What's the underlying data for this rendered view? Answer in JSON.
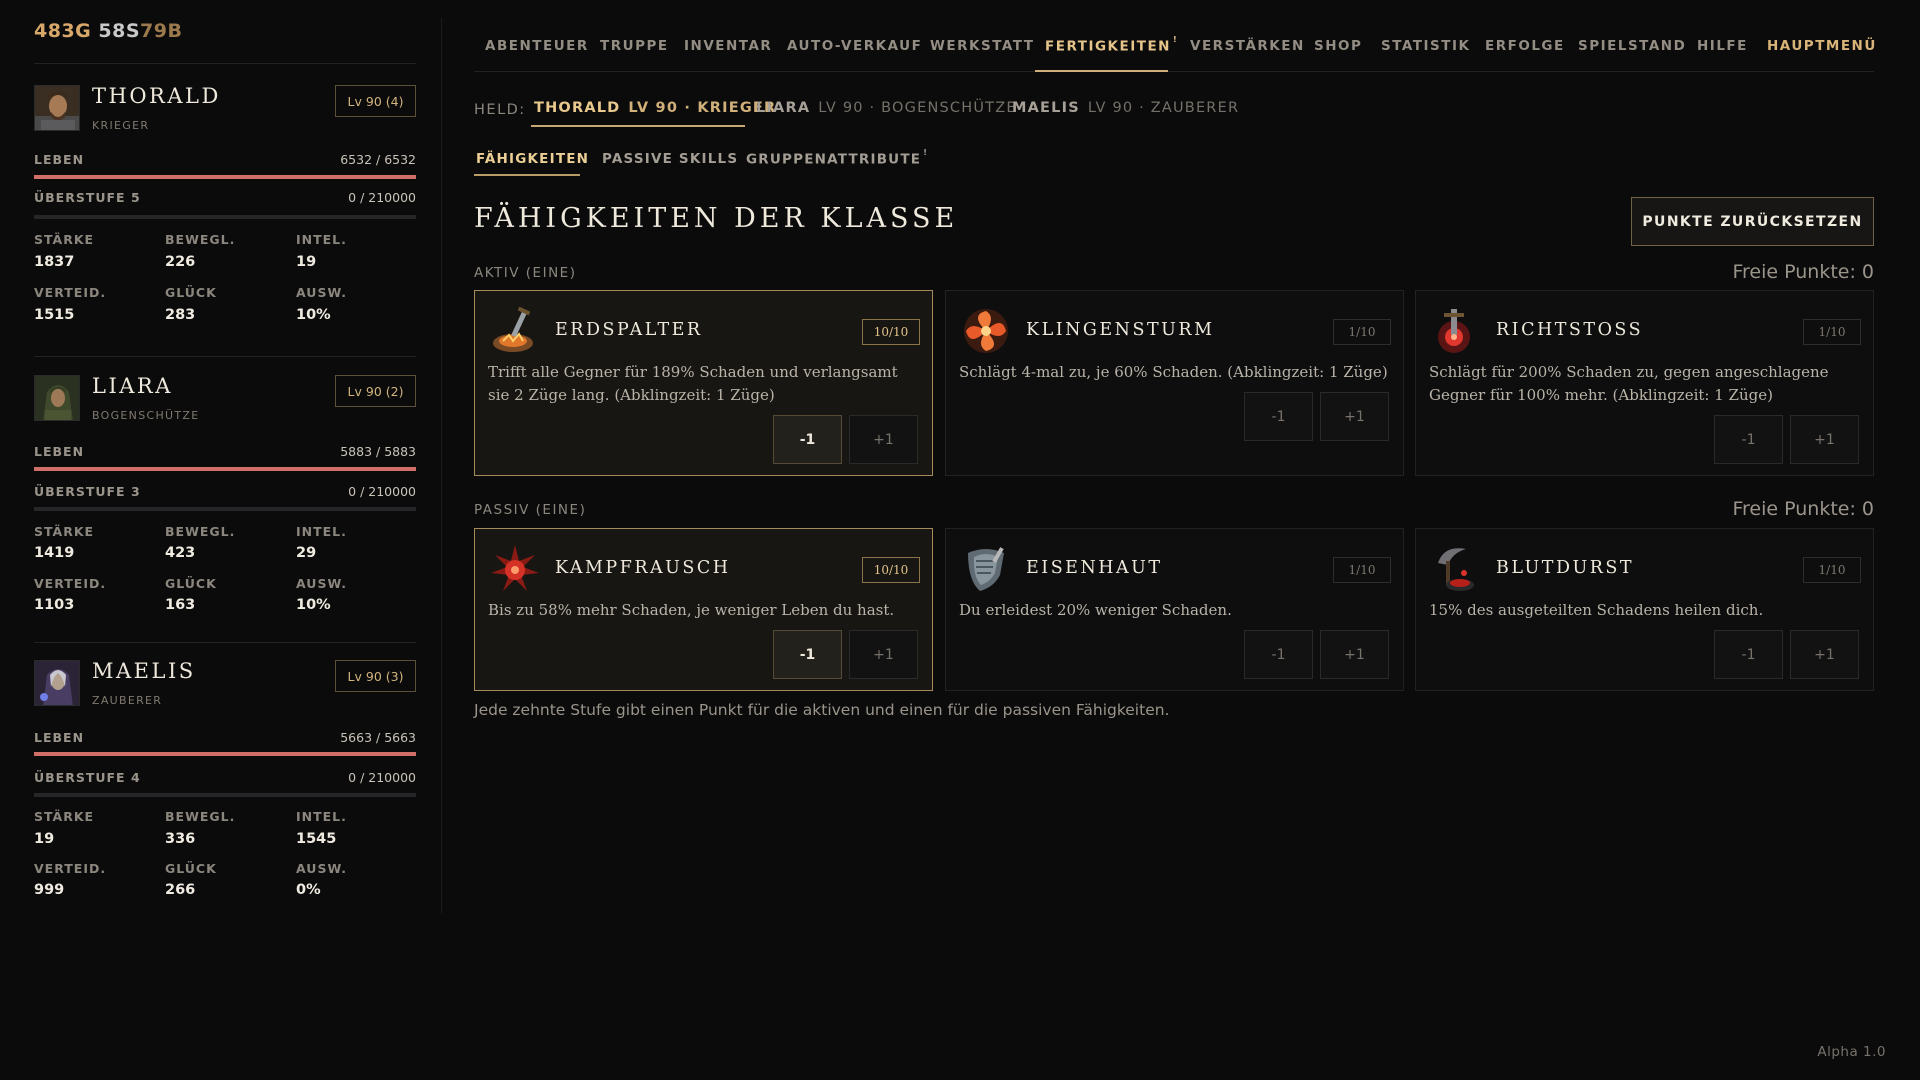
{
  "currency": {
    "gold": "483G",
    "silver": "58S",
    "bronze": "79B"
  },
  "heroes": [
    {
      "name": "THORALD",
      "class": "KRIEGER",
      "level": "Lv 90 (4)",
      "life_label": "LEBEN",
      "life": "6532 / 6532",
      "life_fraction": 1.0,
      "overlevel_label": "ÜBERSTUFE 5",
      "overlevel_xp": "0 / 210000",
      "overlevel_fraction": 0,
      "attrs": [
        {
          "label": "STÄRKE",
          "value": "1837"
        },
        {
          "label": "BEWEGL.",
          "value": "226"
        },
        {
          "label": "INTEL.",
          "value": "19"
        },
        {
          "label": "VERTEID.",
          "value": "1515"
        },
        {
          "label": "GLÜCK",
          "value": "283"
        },
        {
          "label": "AUSW.",
          "value": "10%"
        }
      ]
    },
    {
      "name": "LIARA",
      "class": "BOGENSCHÜTZE",
      "level": "Lv 90 (2)",
      "life_label": "LEBEN",
      "life": "5883 / 5883",
      "life_fraction": 1.0,
      "overlevel_label": "ÜBERSTUFE 3",
      "overlevel_xp": "0 / 210000",
      "overlevel_fraction": 0,
      "attrs": [
        {
          "label": "STÄRKE",
          "value": "1419"
        },
        {
          "label": "BEWEGL.",
          "value": "423"
        },
        {
          "label": "INTEL.",
          "value": "29"
        },
        {
          "label": "VERTEID.",
          "value": "1103"
        },
        {
          "label": "GLÜCK",
          "value": "163"
        },
        {
          "label": "AUSW.",
          "value": "10%"
        }
      ]
    },
    {
      "name": "MAELIS",
      "class": "ZAUBERER",
      "level": "Lv 90 (3)",
      "life_label": "LEBEN",
      "life": "5663 / 5663",
      "life_fraction": 1.0,
      "overlevel_label": "ÜBERSTUFE 4",
      "overlevel_xp": "0 / 210000",
      "overlevel_fraction": 0,
      "attrs": [
        {
          "label": "STÄRKE",
          "value": "19"
        },
        {
          "label": "BEWEGL.",
          "value": "336"
        },
        {
          "label": "INTEL.",
          "value": "1545"
        },
        {
          "label": "VERTEID.",
          "value": "999"
        },
        {
          "label": "GLÜCK",
          "value": "266"
        },
        {
          "label": "AUSW.",
          "value": "0%"
        }
      ]
    }
  ],
  "nav": {
    "items": [
      "ABENTEUER",
      "TRUPPE",
      "INVENTAR",
      "AUTO-VERKAUF",
      "WERKSTATT",
      "FERTIGKEITEN",
      "VERSTÄRKEN",
      "SHOP",
      "STATISTIK",
      "ERFOLGE",
      "SPIELSTAND",
      "HILFE",
      "HAUPTMENÜ"
    ],
    "active": "FERTIGKEITEN",
    "badge": "!"
  },
  "hero_select": {
    "label": "HELD:",
    "tabs": [
      {
        "name": "THORALD",
        "info": "LV 90 · KRIEGER"
      },
      {
        "name": "LIARA",
        "info": "LV 90 · BOGENSCHÜTZE"
      },
      {
        "name": "MAELIS",
        "info": "LV 90 · ZAUBERER"
      }
    ]
  },
  "subtabs": {
    "items": [
      "FÄHIGKEITEN",
      "PASSIVE SKILLS",
      "GRUPPENATTRIBUTE"
    ],
    "badge": "!"
  },
  "page": {
    "title": "FÄHIGKEITEN DER KLASSE",
    "reset_label": "PUNKTE ZURÜCKSETZEN",
    "active_label": "AKTIV (EINE)",
    "passive_label": "PASSIV (EINE)",
    "free_points_active": "Freie Punkte: 0",
    "free_points_passive": "Freie Punkte: 0",
    "footnote": "Jede zehnte Stufe gibt einen Punkt für die aktiven und einen für die passiven Fähigkeiten.",
    "minus_label": "-1",
    "plus_label": "+1"
  },
  "skills_active": [
    {
      "name": "ERDSPALTER",
      "rank": "10/10",
      "icon": "earth-sword-icon",
      "desc": "Trifft alle Gegner für 189% Schaden und verlangsamt sie 2 Züge lang. (Abklingzeit: 1 Züge)"
    },
    {
      "name": "KLINGENSTURM",
      "rank": "1/10",
      "icon": "blade-vortex-icon",
      "desc": "Schlägt 4-mal zu, je 60% Schaden. (Abklingzeit: 1 Züge)"
    },
    {
      "name": "RICHTSTOSS",
      "rank": "1/10",
      "icon": "execution-icon",
      "desc": "Schlägt für 200% Schaden zu, gegen angeschlagene Gegner für 100% mehr. (Abklingzeit: 1 Züge)"
    }
  ],
  "skills_passive": [
    {
      "name": "KAMPFRAUSCH",
      "rank": "10/10",
      "icon": "rage-burst-icon",
      "desc": "Bis zu 58% mehr Schaden, je weniger Leben du hast."
    },
    {
      "name": "EISENHAUT",
      "rank": "1/10",
      "icon": "iron-shield-icon",
      "desc": "Du erleidest 20% weniger Schaden."
    },
    {
      "name": "BLUTDURST",
      "rank": "1/10",
      "icon": "blood-scythe-icon",
      "desc": "15% des ausgeteilten Schadens heilen dich."
    }
  ],
  "version": "Alpha 1.0"
}
